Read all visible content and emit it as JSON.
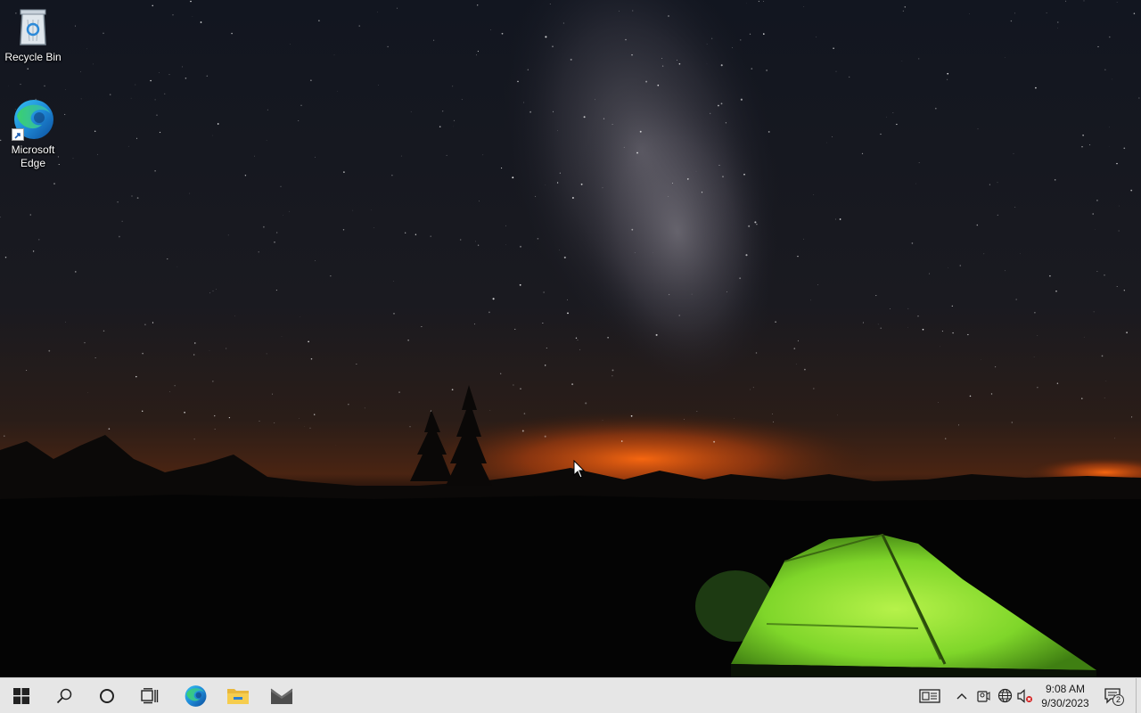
{
  "desktop": {
    "icons": [
      {
        "label": "Recycle Bin",
        "icon": "recycle-bin-icon"
      },
      {
        "label": "Microsoft\nEdge",
        "label_line1": "Microsoft",
        "label_line2": "Edge",
        "icon": "edge-icon"
      }
    ]
  },
  "taskbar": {
    "start": {
      "icon": "windows-logo-icon"
    },
    "search": {
      "icon": "search-icon"
    },
    "cortana": {
      "icon": "cortana-circle-icon"
    },
    "task_view": {
      "icon": "task-view-icon"
    },
    "pinned": [
      {
        "app": "Microsoft Edge",
        "icon": "edge-icon"
      },
      {
        "app": "File Explorer",
        "icon": "folder-icon"
      },
      {
        "app": "Mail",
        "icon": "mail-icon"
      }
    ],
    "tray": {
      "news_icon": "news-widget-icon",
      "chevron_icon": "chevron-up-icon",
      "meet_icon": "meet-now-icon",
      "network_icon": "globe-network-icon",
      "volume_icon": "volume-muted-icon",
      "time": "9:08 AM",
      "date": "9/30/2023",
      "notification_count": "2"
    }
  },
  "colors": {
    "taskbar_bg": "#e6e6e6",
    "tent_green": "#7fd62a",
    "horizon_orange": "#ff6a10"
  }
}
